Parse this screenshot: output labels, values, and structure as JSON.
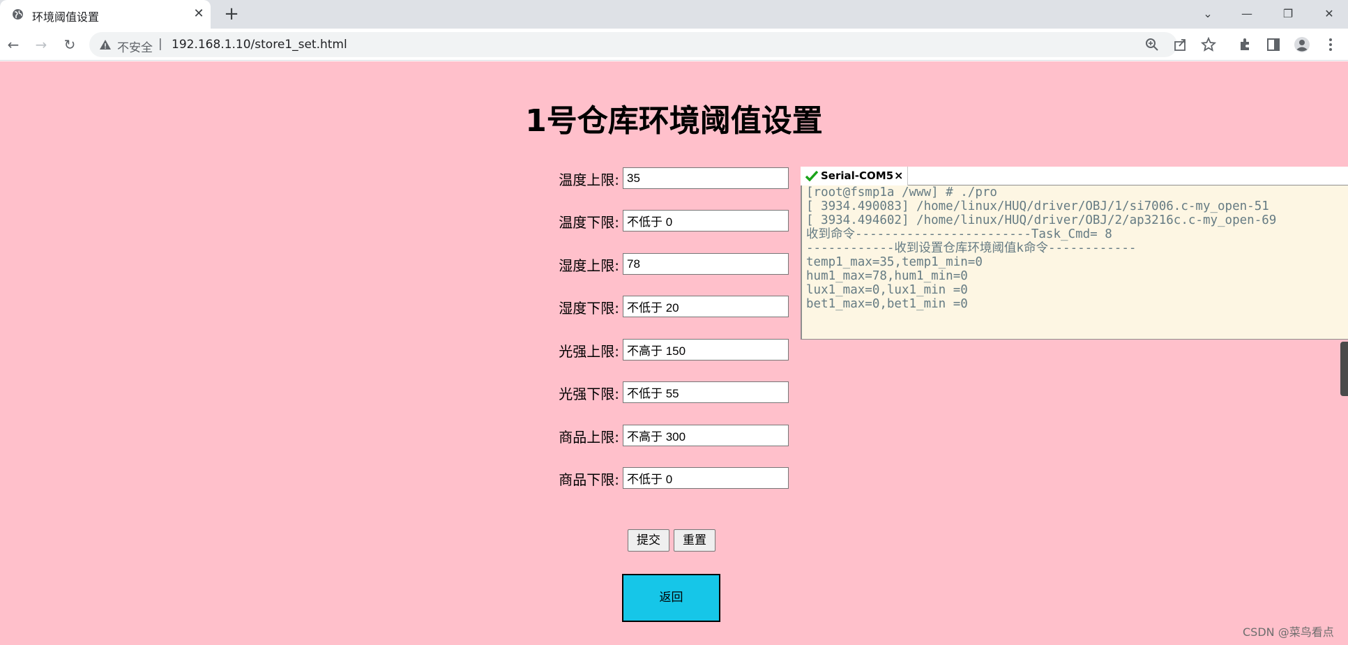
{
  "browser": {
    "tab_title": "环境阈值设置",
    "tab_close": "✕",
    "new_tab": "+",
    "security_label": "不安全",
    "separator": "|",
    "url": "192.168.1.10/store1_set.html",
    "window_controls": {
      "menu": "⌄",
      "minimize": "—",
      "restore": "❐",
      "close": "✕"
    },
    "nav": {
      "back": "←",
      "forward": "→",
      "reload": "↻"
    },
    "icons": [
      "zoom-icon",
      "share-icon",
      "bookmark-star-icon",
      "extensions-icon",
      "side-panel-icon",
      "profile-icon",
      "menu-icon"
    ]
  },
  "page": {
    "title": "1号仓库环境阈值设置",
    "background": "#ffc0cb",
    "fields": [
      {
        "label": "温度上限:",
        "value": "35"
      },
      {
        "label": "温度下限:",
        "value": "不低于 0"
      },
      {
        "label": "湿度上限:",
        "value": "78"
      },
      {
        "label": "湿度下限:",
        "value": "不低于 20"
      },
      {
        "label": "光强上限:",
        "value": "不高于 150"
      },
      {
        "label": "光强下限:",
        "value": "不低于 55"
      },
      {
        "label": "商品上限:",
        "value": "不高于 300"
      },
      {
        "label": "商品下限:",
        "value": "不低于 0"
      }
    ],
    "submit_label": "提交",
    "reset_label": "重置",
    "back_label": "返回",
    "back_color": "#16c6e8"
  },
  "serial": {
    "tab_name": "Serial-COM5",
    "tab_close": "×",
    "lines": [
      "[root@fsmp1a /www] # ./pro",
      "[ 3934.490083] /home/linux/HUQ/driver/OBJ/1/si7006.c-my_open-51",
      "[ 3934.494602] /home/linux/HUQ/driver/OBJ/2/ap3216c.c-my_open-69",
      "收到命令------------------------Task_Cmd= 8",
      "------------收到设置仓库环境阈值k命令------------",
      "temp1_max=35,temp1_min=0",
      "hum1_max=78,hum1_min=0",
      "lux1_max=0,lux1_min =0",
      "bet1_max=0,bet1_min =0"
    ]
  },
  "watermark": "CSDN @菜鸟看点"
}
